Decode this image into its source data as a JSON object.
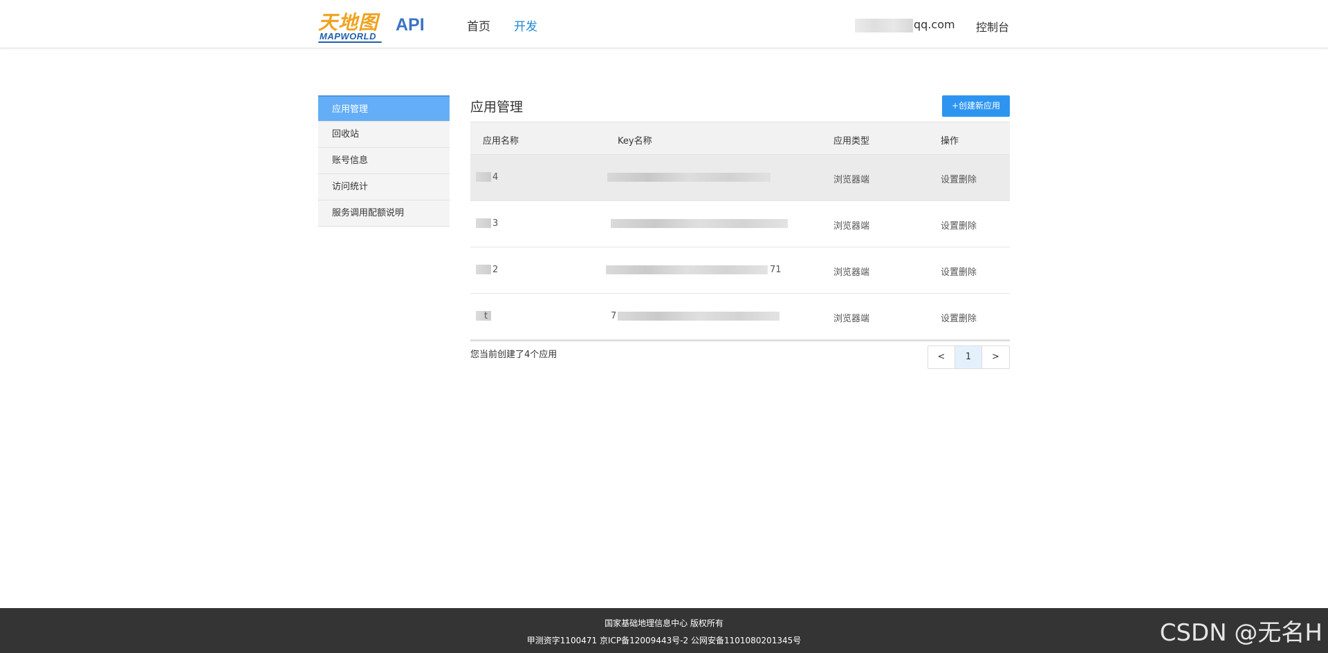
{
  "header": {
    "logo_cn": "天地图",
    "logo_en": "MAPWORLD",
    "api_title": "API",
    "nav": [
      {
        "label": "首页"
      },
      {
        "label": "开发"
      }
    ],
    "user_email": "qq.com",
    "console_label": "控制台"
  },
  "sidebar": {
    "items": [
      {
        "label": "应用管理"
      },
      {
        "label": "回收站"
      },
      {
        "label": "账号信息"
      },
      {
        "label": "访问统计"
      },
      {
        "label": "服务调用配额说明"
      }
    ]
  },
  "main": {
    "title": "应用管理",
    "create_button": "+创建新应用",
    "columns": [
      "应用名称",
      "Key名称",
      "应用类型",
      "操作"
    ],
    "rows": [
      {
        "name": "4",
        "key": "",
        "type": "浏览器端",
        "op_set": "设置",
        "op_delete": "删除"
      },
      {
        "name": "3",
        "key": "",
        "type": "浏览器端",
        "op_set": "设置",
        "op_delete": "删除"
      },
      {
        "name": "2",
        "key": "71",
        "type": "浏览器端",
        "op_set": "设置",
        "op_delete": "删除"
      },
      {
        "name": "t",
        "key": "7",
        "type": "浏览器端",
        "op_set": "设置",
        "op_delete": "删除"
      }
    ],
    "summary": "您当前创建了4个应用",
    "pager": {
      "prev": "<",
      "current": "1",
      "next": ">"
    }
  },
  "footer": {
    "line1": "国家基础地理信息中心  版权所有",
    "line2": "甲测资字1100471  京ICP备12009443号-2  公网安备1101080201345号"
  },
  "watermark": "CSDN @无名H",
  "colors": {
    "accent": "#2d95f0",
    "active_sidebar": "#64aef7",
    "footer_bg": "#343434"
  }
}
